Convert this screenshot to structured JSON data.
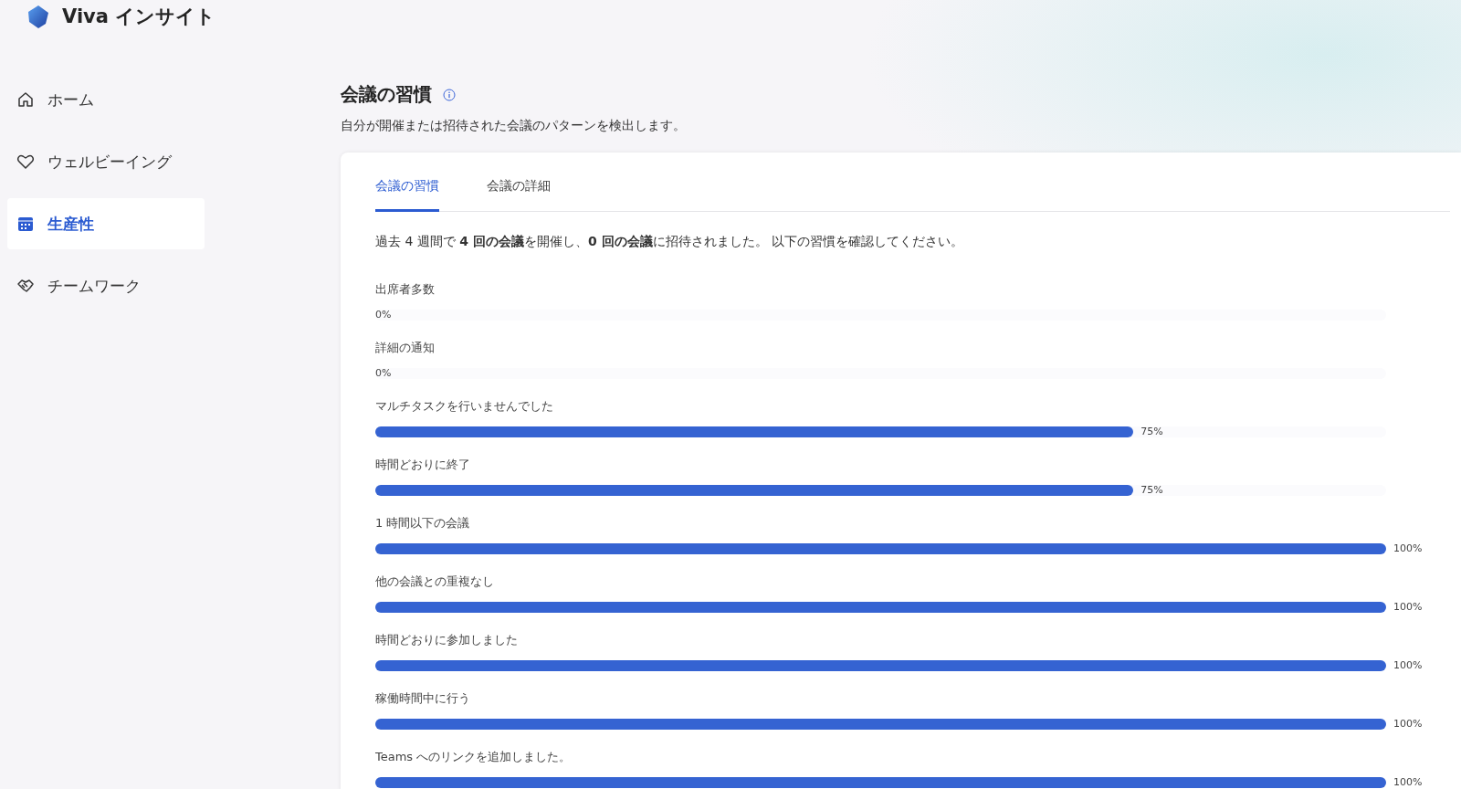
{
  "app": {
    "title": "Viva インサイト"
  },
  "sidebar": {
    "items": [
      {
        "label": "ホーム",
        "kind": "home",
        "selected": false
      },
      {
        "label": "ウェルビーイング",
        "kind": "heart",
        "selected": false
      },
      {
        "label": "生産性",
        "kind": "calendar",
        "selected": true
      },
      {
        "label": "チームワーク",
        "kind": "handshake",
        "selected": false
      }
    ]
  },
  "page": {
    "title": "会議の習慣",
    "subtitle": "自分が開催または招待された会議のパターンを検出します。"
  },
  "tabs": [
    {
      "label": "会議の習慣",
      "selected": true
    },
    {
      "label": "会議の詳細",
      "selected": false
    }
  ],
  "summary": "過去 4 週間で **4 回の会議**を開催し、**0 回の会議**に招待されました。 以下の習慣を確認してください。",
  "habits": [
    {
      "label": "出席者多数",
      "level": 0,
      "reading": "0%"
    },
    {
      "label": "詳細の通知",
      "level": 0,
      "reading": "0%"
    },
    {
      "label": "マルチタスクを行いませんでした",
      "level": 0.75,
      "reading": "75%"
    },
    {
      "label": "時間どおりに終了",
      "level": 0.75,
      "reading": "75%"
    },
    {
      "label": "1 時間以下の会議",
      "level": 1,
      "reading": "100%"
    },
    {
      "label": "他の会議との重複なし",
      "level": 1,
      "reading": "100%"
    },
    {
      "label": "時間どおりに参加しました",
      "level": 1,
      "reading": "100%"
    },
    {
      "label": "稼働時間中に行う",
      "level": 1,
      "reading": "100%"
    },
    {
      "label": "Teams へのリンクを追加しました。",
      "level": 1,
      "reading": "100%"
    }
  ]
}
